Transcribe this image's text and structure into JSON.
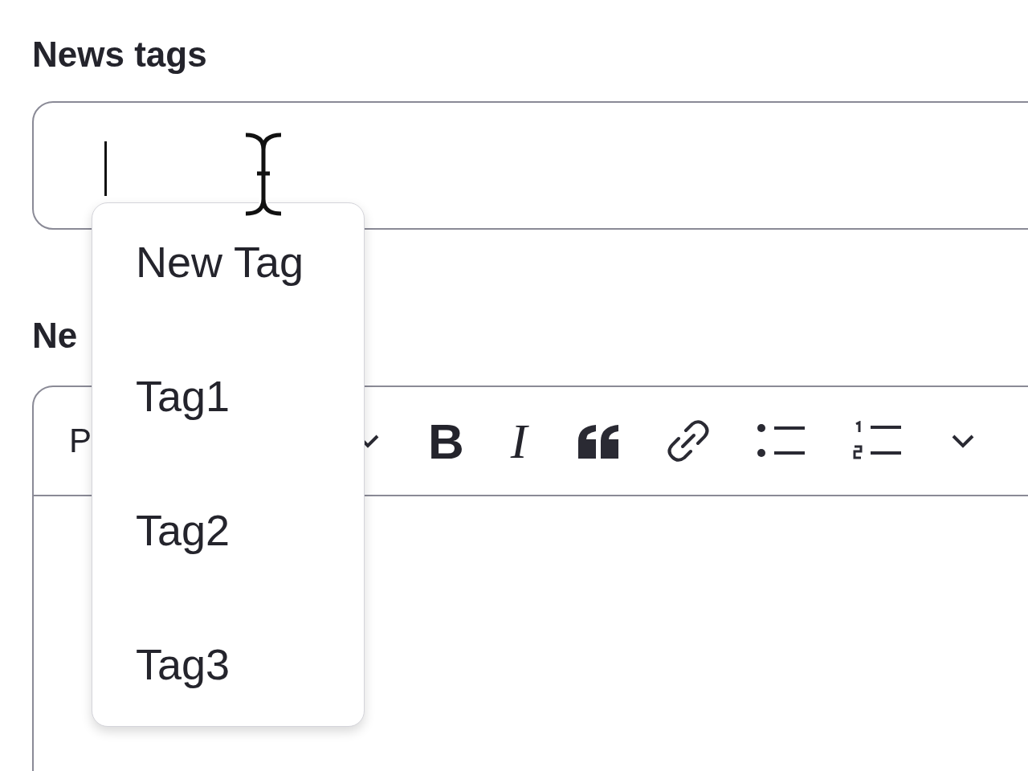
{
  "tags_field": {
    "label": "News tags",
    "focused": true
  },
  "tag_menu": {
    "items": [
      {
        "label": "New Tag",
        "selected": false
      },
      {
        "label": "Tag1",
        "selected": false
      },
      {
        "label": "Tag2",
        "selected": false
      },
      {
        "label": "Tag3",
        "selected": false
      }
    ]
  },
  "content_field": {
    "label": "Ne",
    "toolbar": [
      {
        "kind": "style",
        "label": "P"
      },
      {
        "kind": "caret"
      },
      {
        "kind": "bold",
        "label": "B"
      },
      {
        "kind": "italic",
        "label": "I"
      },
      {
        "kind": "quote"
      },
      {
        "kind": "link"
      },
      {
        "kind": "bullets"
      },
      {
        "kind": "numbered"
      },
      {
        "kind": "caret"
      }
    ]
  }
}
